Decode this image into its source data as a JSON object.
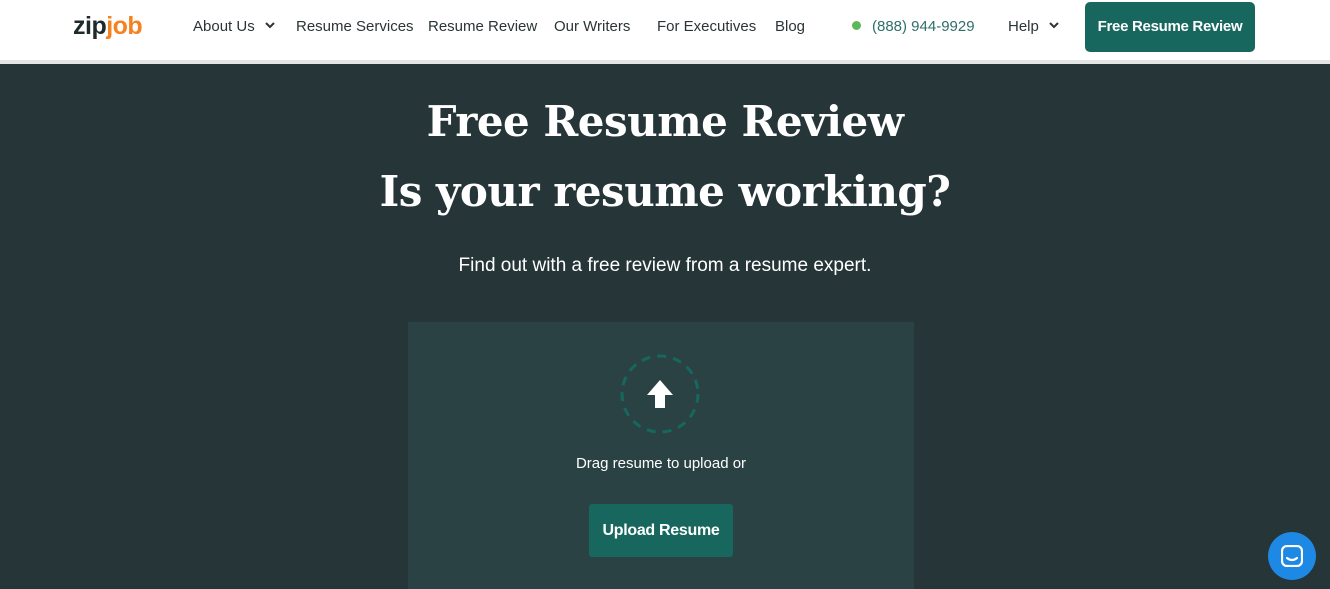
{
  "brand": {
    "zip": "zip",
    "job": "job",
    "accent": "#f5811f"
  },
  "nav": {
    "about": "About Us",
    "services": "Resume Services",
    "review": "Resume Review",
    "writers": "Our Writers",
    "executives": "For Executives",
    "blog": "Blog",
    "phone": "(888) 944-9929",
    "help": "Help",
    "cta": "Free Resume Review"
  },
  "hero": {
    "title1": "Free Resume Review",
    "title2": "Is your resume working?",
    "subtitle": "Find out with a free review from a resume expert."
  },
  "upload": {
    "icon": "upload-arrow-icon",
    "drag_text": "Drag resume to upload or",
    "button": "Upload Resume"
  },
  "chat": {
    "icon": "chat-icon"
  },
  "colors": {
    "teal": "#17675f",
    "hero_bg": "#263538",
    "panel_bg": "#2a4244",
    "status_dot": "#5cb85c"
  }
}
